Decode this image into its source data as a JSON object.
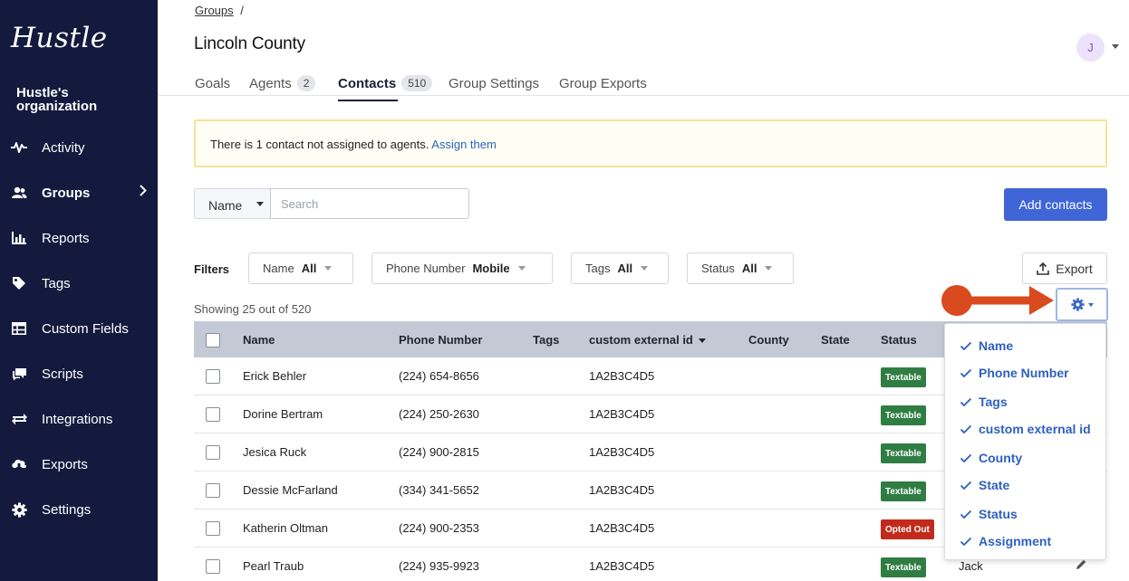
{
  "sidebar": {
    "brand": "Hustle",
    "org": "Hustle's organization",
    "items": [
      {
        "label": "Activity",
        "icon": "activity-icon"
      },
      {
        "label": "Groups",
        "icon": "users-icon"
      },
      {
        "label": "Reports",
        "icon": "bar-chart-icon"
      },
      {
        "label": "Tags",
        "icon": "tag-icon"
      },
      {
        "label": "Custom Fields",
        "icon": "table-icon"
      },
      {
        "label": "Scripts",
        "icon": "chat-icon"
      },
      {
        "label": "Integrations",
        "icon": "exchange-icon"
      },
      {
        "label": "Exports",
        "icon": "cloud-download-icon"
      },
      {
        "label": "Settings",
        "icon": "gear-icon"
      }
    ],
    "active": "Groups"
  },
  "header": {
    "breadcrumb_link": "Groups",
    "breadcrumb_sep": "/",
    "title": "Lincoln County",
    "avatar_initial": "J"
  },
  "tabs": [
    {
      "label": "Goals",
      "count": ""
    },
    {
      "label": "Agents",
      "count": "2"
    },
    {
      "label": "Contacts",
      "count": "510"
    },
    {
      "label": "Group Settings",
      "count": ""
    },
    {
      "label": "Group Exports",
      "count": ""
    }
  ],
  "alert": {
    "text": "There is 1 contact not assigned to agents.",
    "link": "Assign them"
  },
  "search": {
    "field": "Name",
    "placeholder": "Search",
    "add_button": "Add contacts"
  },
  "filters": {
    "label": "Filters",
    "items": [
      {
        "name": "Name",
        "value": "All"
      },
      {
        "name": "Phone Number",
        "value": "Mobile"
      },
      {
        "name": "Tags",
        "value": "All"
      },
      {
        "name": "Status",
        "value": "All"
      }
    ],
    "export": "Export"
  },
  "showing": "Showing 25 out of 520",
  "table": {
    "columns": [
      "Name",
      "Phone Number",
      "Tags",
      "custom external id",
      "County",
      "State",
      "Status"
    ],
    "rows": [
      {
        "name": "Erick Behler",
        "phone": "(224) 654-8656",
        "ext_id": "1A2B3C4D5",
        "status": "Textable",
        "agent": ""
      },
      {
        "name": "Dorine Bertram",
        "phone": "(224) 250-2630",
        "ext_id": "1A2B3C4D5",
        "status": "Textable",
        "agent": ""
      },
      {
        "name": "Jesica Ruck",
        "phone": "(224) 900-2815",
        "ext_id": "1A2B3C4D5",
        "status": "Textable",
        "agent": ""
      },
      {
        "name": "Dessie McFarland",
        "phone": "(334) 341-5652",
        "ext_id": "1A2B3C4D5",
        "status": "Textable",
        "agent": ""
      },
      {
        "name": "Katherin Oltman",
        "phone": "(224) 900-2353",
        "ext_id": "1A2B3C4D5",
        "status": "Opted Out",
        "agent": ""
      },
      {
        "name": "Pearl Traub",
        "phone": "(224) 935-9923",
        "ext_id": "1A2B3C4D5",
        "status": "Textable",
        "agent": "Jack"
      }
    ]
  },
  "column_menu": {
    "items": [
      "Name",
      "Phone Number",
      "Tags",
      "custom external id",
      "County",
      "State",
      "Status",
      "Assignment"
    ]
  },
  "colors": {
    "sidebar_bg": "#131a3d",
    "primary": "#3f65d6",
    "textable": "#2f7d43",
    "opted_out": "#c22a1b",
    "annotation_arrow": "#d94a1e"
  }
}
